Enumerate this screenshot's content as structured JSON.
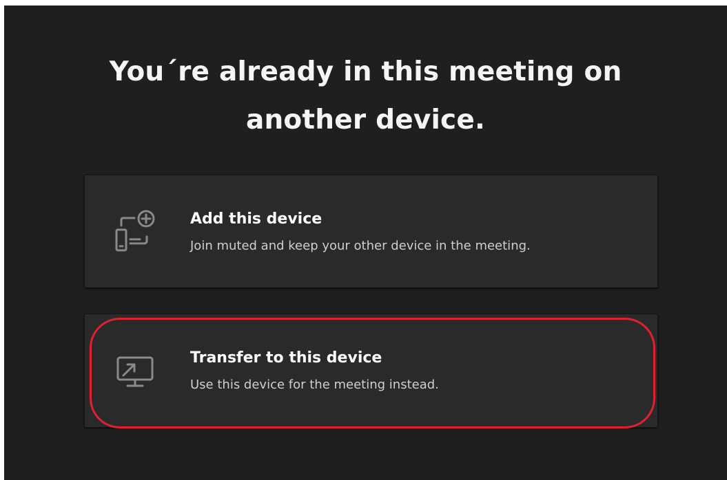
{
  "dialog": {
    "title_line1": "You´re already in this meeting on",
    "title_line2": "another device."
  },
  "options": [
    {
      "icon": "add-device-icon",
      "label": "Add this device",
      "description": "Join muted and keep your other device in the meeting."
    },
    {
      "icon": "transfer-device-icon",
      "label": "Transfer to this device",
      "description": "Use this device for the meeting instead."
    }
  ],
  "colors": {
    "background": "#1f1f1f",
    "card": "#2a2a2a",
    "highlight": "#e3202f",
    "icon": "#8a8a8a"
  }
}
